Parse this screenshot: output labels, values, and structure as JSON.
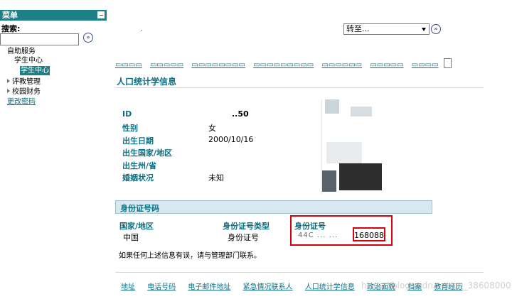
{
  "sidebar": {
    "menu_title": "菜单",
    "search_label": "搜索:",
    "search_value": "",
    "items": [
      {
        "label": "自助服务"
      },
      {
        "label": "学生中心"
      },
      {
        "label": "学生中心",
        "selected": true
      },
      {
        "label": "评教管理"
      },
      {
        "label": "校园财务"
      },
      {
        "label": "更改密码"
      }
    ]
  },
  "header": {
    "dot": ".",
    "goto_label": "转至..."
  },
  "main": {
    "section_title": "人口统计学信息",
    "fields": [
      {
        "label": "ID",
        "value": "..50"
      },
      {
        "label": "性别",
        "value": "女"
      },
      {
        "label": "出生日期",
        "value": "2000/10/16"
      },
      {
        "label": "出生国家/地区",
        "value": ""
      },
      {
        "label": "出生州/省",
        "value": ""
      },
      {
        "label": "婚姻状况",
        "value": "未知"
      }
    ],
    "id_section": {
      "title": "身份证号码",
      "headers": [
        "国家/地区",
        "身份证号类型",
        "身份证号"
      ],
      "row": {
        "country": "中国",
        "type": "身份证号",
        "number_blurred": "44C ... ...",
        "number_tail": "168088"
      }
    },
    "footer_note": "如果任何上述信息有误，请与管理部门联系。"
  },
  "bottom_nav": {
    "items": [
      "地址",
      "电话号码",
      "电子邮件地址",
      "紧急情况联系人",
      "人口统计学信息",
      "政治面貌",
      "档案",
      "教育经历"
    ]
  },
  "watermark": "https://blog.csdn.net/qq_38608000",
  "colors": {
    "accent": "#1f7f86",
    "link": "#0a6f83",
    "highlight_box": "#d9000d"
  }
}
